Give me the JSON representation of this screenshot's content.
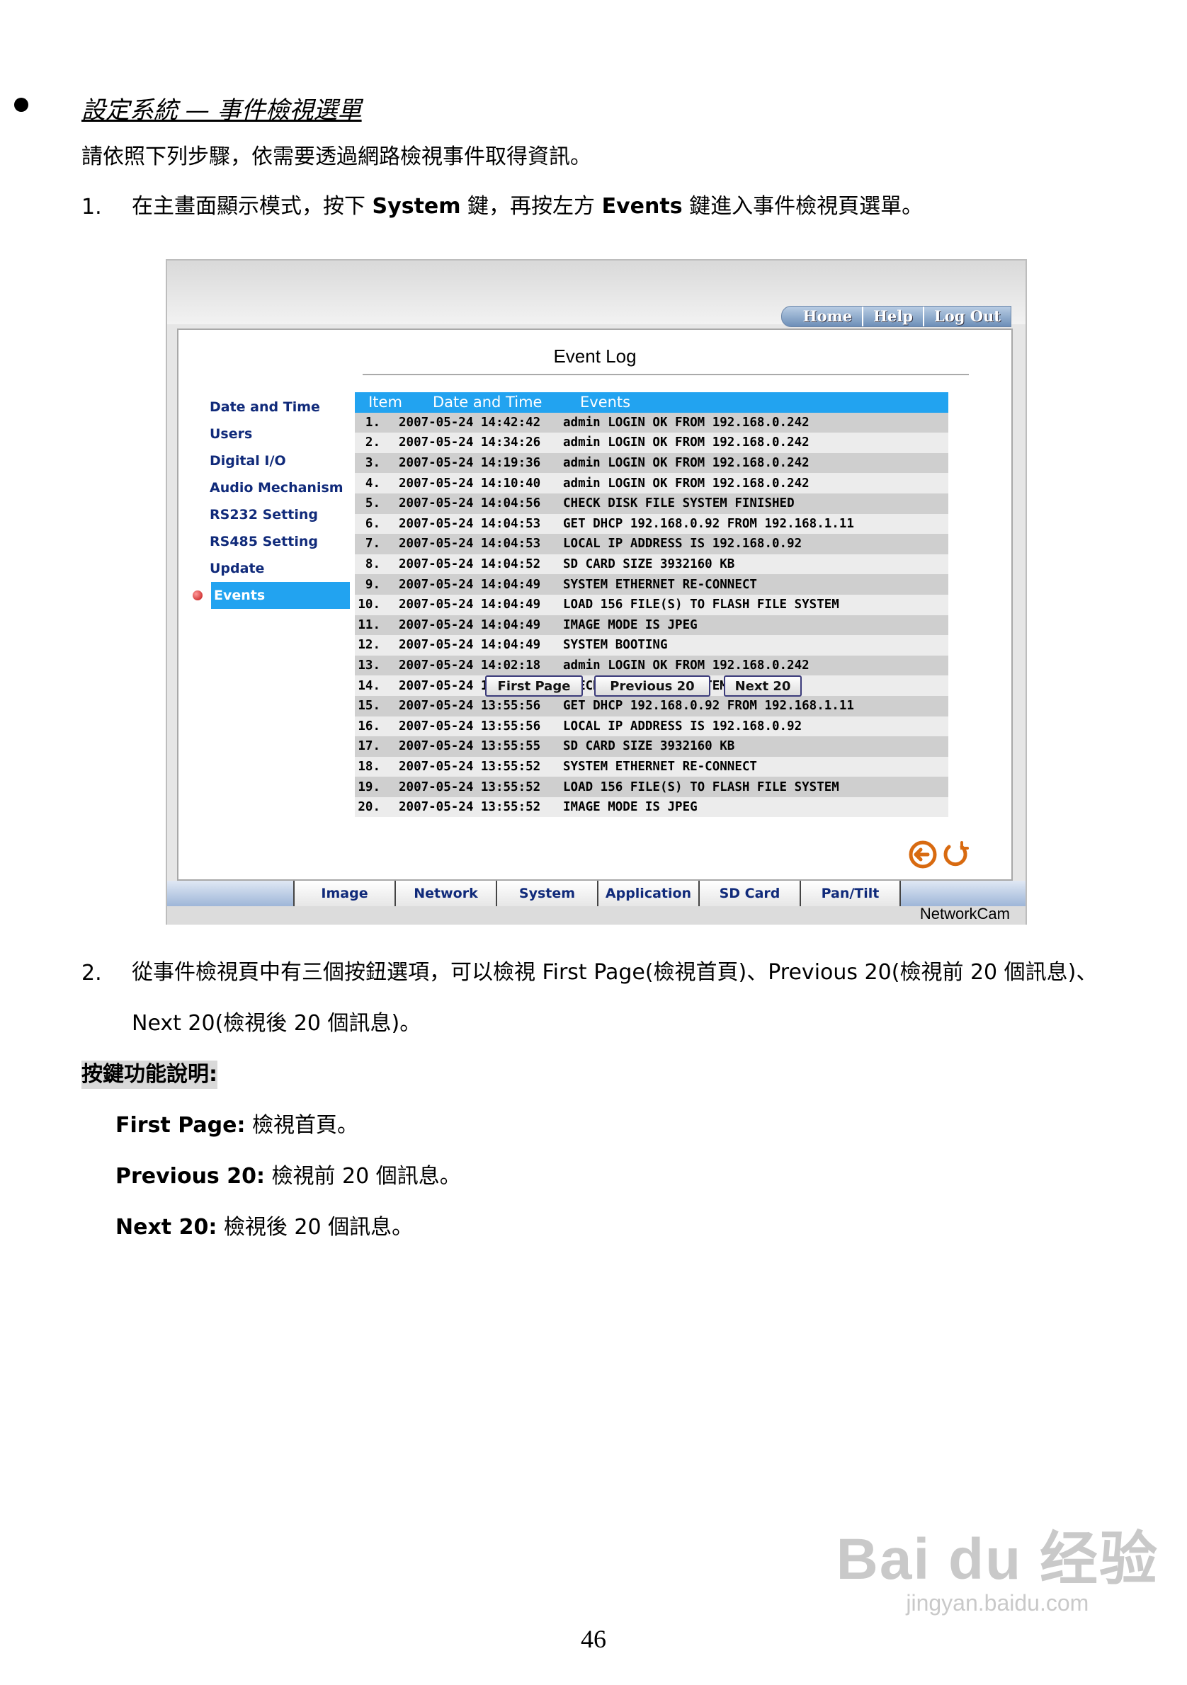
{
  "doc": {
    "heading": "設定系統 — 事件檢視選單",
    "intro": "請依照下列步驟，依需要透過網路檢視事件取得資訊。",
    "step1": {
      "num": "1.",
      "pre": "在主畫面顯示模式，按下 ",
      "b1": "System",
      "mid": " 鍵，再按左方 ",
      "b2": "Events",
      "post": " 鍵進入事件檢視頁選單。"
    },
    "step2": {
      "num": "2.",
      "line1": "從事件檢視頁中有三個按鈕選項，可以檢視 First Page(檢視首頁)、Previous 20(檢視前 20 個訊息)、",
      "line2": "Next 20(檢視後 20 個訊息)。"
    },
    "section": "按鍵功能說明:",
    "defs": [
      {
        "term": "First Page:",
        "desc": " 檢視首頁。"
      },
      {
        "term": "Previous 20:",
        "desc": " 檢視前 20 個訊息。"
      },
      {
        "term": "Next 20:",
        "desc": " 檢視後 20 個訊息。"
      }
    ],
    "page_number": "46",
    "watermark": {
      "big": "Bai du 经验",
      "small": "jingyan.baidu.com"
    }
  },
  "screenshot": {
    "top_nav": [
      "Home",
      "Help",
      "Log Out"
    ],
    "title": "Event Log",
    "sidebar": [
      "Date and Time",
      "Users",
      "Digital I/O",
      "Audio Mechanism",
      "RS232 Setting",
      "RS485 Setting",
      "Update",
      "Events"
    ],
    "table_headers": [
      "Item",
      "Date and Time",
      "Events"
    ],
    "rows": [
      [
        "1.",
        "2007-05-24 14:42:42",
        "admin LOGIN OK FROM 192.168.0.242"
      ],
      [
        "2.",
        "2007-05-24 14:34:26",
        "admin LOGIN OK FROM 192.168.0.242"
      ],
      [
        "3.",
        "2007-05-24 14:19:36",
        "admin LOGIN OK FROM 192.168.0.242"
      ],
      [
        "4.",
        "2007-05-24 14:10:40",
        "admin LOGIN OK FROM 192.168.0.242"
      ],
      [
        "5.",
        "2007-05-24 14:04:56",
        "CHECK DISK FILE SYSTEM FINISHED"
      ],
      [
        "6.",
        "2007-05-24 14:04:53",
        "GET DHCP 192.168.0.92 FROM 192.168.1.11"
      ],
      [
        "7.",
        "2007-05-24 14:04:53",
        "LOCAL IP ADDRESS IS 192.168.0.92"
      ],
      [
        "8.",
        "2007-05-24 14:04:52",
        "SD CARD SIZE 3932160 KB"
      ],
      [
        "9.",
        "2007-05-24 14:04:49",
        "SYSTEM ETHERNET RE-CONNECT"
      ],
      [
        "10.",
        "2007-05-24 14:04:49",
        "LOAD 156 FILE(S) TO FLASH FILE SYSTEM"
      ],
      [
        "11.",
        "2007-05-24 14:04:49",
        "IMAGE MODE IS JPEG"
      ],
      [
        "12.",
        "2007-05-24 14:04:49",
        "SYSTEM BOOTING"
      ],
      [
        "13.",
        "2007-05-24 14:02:18",
        "admin LOGIN OK FROM 192.168.0.242"
      ],
      [
        "14.",
        "2007-05-24 13:55:59",
        "CHECK DISK FILE SYSTEM FINISHED"
      ],
      [
        "15.",
        "2007-05-24 13:55:56",
        "GET DHCP 192.168.0.92 FROM 192.168.1.11"
      ],
      [
        "16.",
        "2007-05-24 13:55:56",
        "LOCAL IP ADDRESS IS 192.168.0.92"
      ],
      [
        "17.",
        "2007-05-24 13:55:55",
        "SD CARD SIZE 3932160 KB"
      ],
      [
        "18.",
        "2007-05-24 13:55:52",
        "SYSTEM ETHERNET RE-CONNECT"
      ],
      [
        "19.",
        "2007-05-24 13:55:52",
        "LOAD 156 FILE(S) TO FLASH FILE SYSTEM"
      ],
      [
        "20.",
        "2007-05-24 13:55:52",
        "IMAGE MODE IS JPEG"
      ]
    ],
    "pager": {
      "first": "First Page",
      "prev": "Previous 20",
      "next": "Next 20"
    },
    "bottom_tabs": [
      "Image",
      "Network",
      "System",
      "Application",
      "SD Card",
      "Pan/Tilt"
    ],
    "brand": "NetworkCam",
    "colors": {
      "header_blue": "#22a3f0",
      "nav_text": "#102a7a"
    }
  }
}
